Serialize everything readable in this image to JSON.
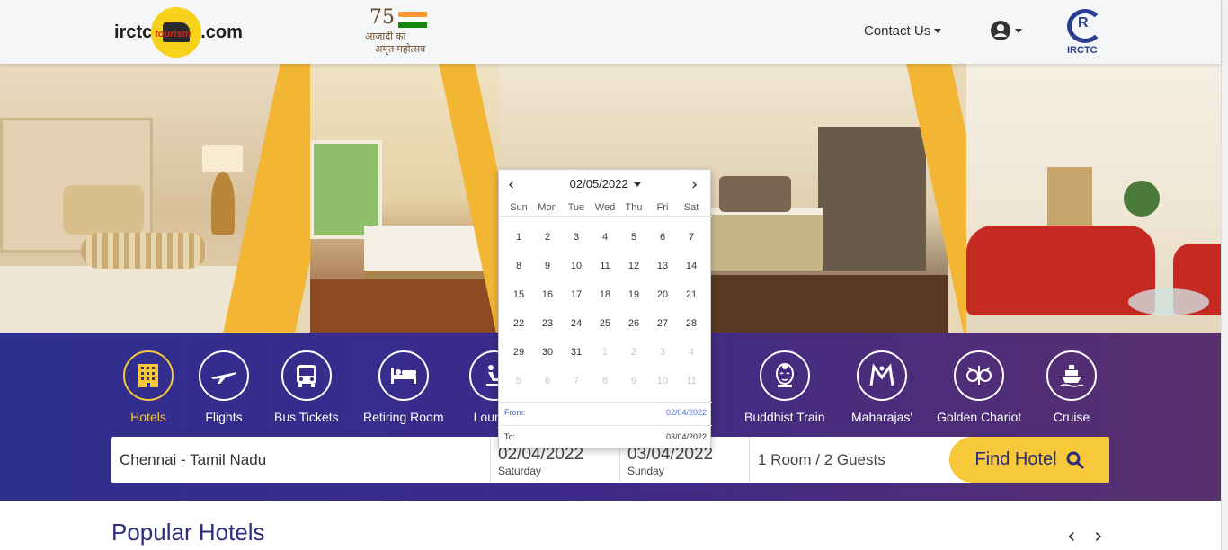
{
  "header": {
    "logo": {
      "left": "irctc",
      "right": ".com",
      "badge_text": "tourism"
    },
    "azadi": {
      "num": "75",
      "line1": "आज़ादी का",
      "line2": "अमृत महोत्सव"
    },
    "contact_label": "Contact Us",
    "irctc_logo_text": "IRCTC",
    "irctc_logo_mark": "R"
  },
  "categories": [
    {
      "label": "Hotels",
      "icon": "building-icon",
      "active": true
    },
    {
      "label": "Flights",
      "icon": "airplane-icon"
    },
    {
      "label": "Bus Tickets",
      "icon": "bus-icon"
    },
    {
      "label": "Retiring Room",
      "icon": "bed-icon"
    },
    {
      "label": "Lounge",
      "icon": "lounge-chair-icon"
    },
    {
      "label": "Buddhist Train",
      "icon": "buddha-icon"
    },
    {
      "label": "Maharajas'",
      "icon": "maharajas-logo-icon"
    },
    {
      "label": "Golden Chariot",
      "icon": "golden-chariot-icon"
    },
    {
      "label": "Cruise",
      "icon": "ship-icon"
    }
  ],
  "search": {
    "city": "Chennai - Tamil Nadu",
    "checkin_date": "02/04/2022",
    "checkin_day": "Saturday",
    "checkout_date": "03/04/2022",
    "checkout_day": "Sunday",
    "guests": "1 Room / 2 Guests",
    "button_label": "Find Hotel"
  },
  "calendar": {
    "month_label": "02/05/2022",
    "weekdays": [
      "Sun",
      "Mon",
      "Tue",
      "Wed",
      "Thu",
      "Fri",
      "Sat"
    ],
    "weeks": [
      [
        [
          "1",
          0
        ],
        [
          "2",
          0
        ],
        [
          "3",
          0
        ],
        [
          "4",
          0
        ],
        [
          "5",
          0
        ],
        [
          "6",
          0
        ],
        [
          "7",
          0
        ]
      ],
      [
        [
          "8",
          0
        ],
        [
          "9",
          0
        ],
        [
          "10",
          0
        ],
        [
          "11",
          0
        ],
        [
          "12",
          0
        ],
        [
          "13",
          0
        ],
        [
          "14",
          0
        ]
      ],
      [
        [
          "15",
          0
        ],
        [
          "16",
          0
        ],
        [
          "17",
          0
        ],
        [
          "18",
          0
        ],
        [
          "19",
          0
        ],
        [
          "20",
          0
        ],
        [
          "21",
          0
        ]
      ],
      [
        [
          "22",
          0
        ],
        [
          "23",
          0
        ],
        [
          "24",
          0
        ],
        [
          "25",
          0
        ],
        [
          "26",
          0
        ],
        [
          "27",
          0
        ],
        [
          "28",
          0
        ]
      ],
      [
        [
          "29",
          0
        ],
        [
          "30",
          0
        ],
        [
          "31",
          0
        ],
        [
          "1",
          1
        ],
        [
          "2",
          1
        ],
        [
          "3",
          1
        ],
        [
          "4",
          1
        ]
      ],
      [
        [
          "5",
          1
        ],
        [
          "6",
          1
        ],
        [
          "7",
          1
        ],
        [
          "8",
          1
        ],
        [
          "9",
          1
        ],
        [
          "10",
          1
        ],
        [
          "11",
          1
        ]
      ]
    ],
    "from_label": "From:",
    "from_value": "02/04/2022",
    "to_label": "To:",
    "to_value": "03/04/2022"
  },
  "popular": {
    "title": "Popular Hotels"
  },
  "colors": {
    "accent_yellow": "#f6c83a",
    "brand_navy": "#2b2d7a",
    "link_blue": "#4a6fd6"
  }
}
